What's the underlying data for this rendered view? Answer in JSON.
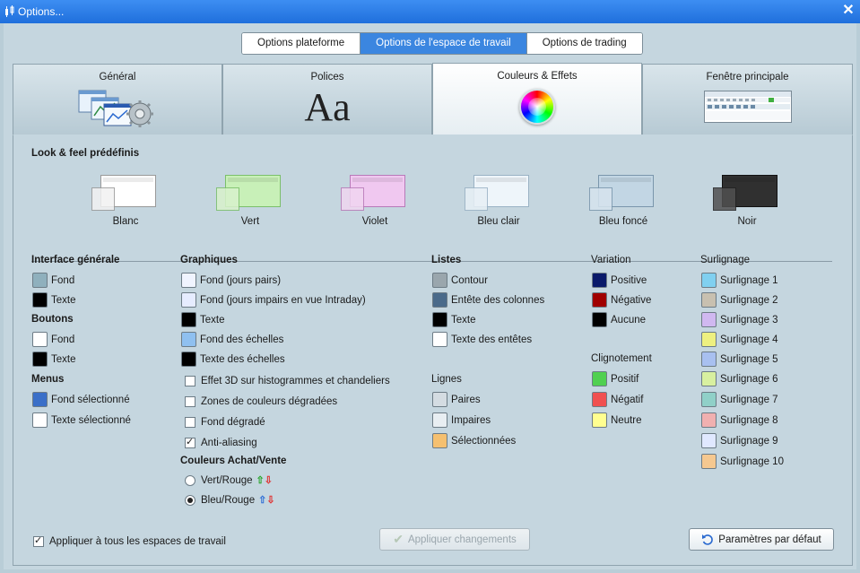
{
  "window": {
    "title": "Options..."
  },
  "top_segments": [
    {
      "label": "Options plateforme",
      "active": false
    },
    {
      "label": "Options de l'espace de travail",
      "active": true
    },
    {
      "label": "Options de trading",
      "active": false
    }
  ],
  "tabs": [
    {
      "label": "Général",
      "icon": "windows-gear-icon",
      "active": false
    },
    {
      "label": "Polices",
      "icon": "font-aa-icon",
      "icon_text": "Aa",
      "active": false
    },
    {
      "label": "Couleurs & Effets",
      "icon": "color-wheel-icon",
      "active": true
    },
    {
      "label": "Fenêtre principale",
      "icon": "main-window-preview-icon",
      "active": false
    }
  ],
  "look_feel": {
    "title": "Look & feel prédéfinis",
    "presets": [
      {
        "label": "Blanc",
        "back": "#ffffff",
        "front": "#f2f2f2"
      },
      {
        "label": "Vert",
        "back": "#c8f0b8",
        "front": "#d8f2cc"
      },
      {
        "label": "Violet",
        "back": "#f0c8f0",
        "front": "#f0d6f0"
      },
      {
        "label": "Bleu clair",
        "back": "#eef5fa",
        "front": "#e8f0f6"
      },
      {
        "label": "Bleu foncé",
        "back": "#c2d6e4",
        "front": "#d6e4ee"
      },
      {
        "label": "Noir",
        "back": "#303030",
        "front": "#505050"
      }
    ]
  },
  "interface": {
    "title": "Interface générale",
    "items": [
      {
        "label": "Fond",
        "color": "#8fb0bd"
      },
      {
        "label": "Texte",
        "color": "#000000"
      }
    ]
  },
  "boutons": {
    "title": "Boutons",
    "items": [
      {
        "label": "Fond",
        "color": "#ffffff"
      },
      {
        "label": "Texte",
        "color": "#000000"
      }
    ]
  },
  "menus": {
    "title": "Menus",
    "items": [
      {
        "label": "Fond sélectionné",
        "color": "#3a6fc8"
      },
      {
        "label": "Texte sélectionné",
        "color": "#ffffff"
      }
    ]
  },
  "graphiques": {
    "title": "Graphiques",
    "items": [
      {
        "label": "Fond (jours pairs)",
        "color": "#f0f4ff"
      },
      {
        "label": "Fond (jours impairs en vue Intraday)",
        "color": "#e6ecff"
      },
      {
        "label": "Texte",
        "color": "#000000"
      },
      {
        "label": "Fond des échelles",
        "color": "#8fc0f0"
      },
      {
        "label": "Texte des échelles",
        "color": "#000000"
      }
    ],
    "checks": [
      {
        "label": "Effet 3D sur histogrammes et chandeliers",
        "checked": false
      },
      {
        "label": "Zones de couleurs dégradées",
        "checked": false
      },
      {
        "label": "Fond dégradé",
        "checked": false
      },
      {
        "label": "Anti-aliasing",
        "checked": true
      }
    ]
  },
  "achat_vente": {
    "title": "Couleurs Achat/Vente",
    "options": [
      {
        "label": "Vert/Rouge",
        "checked": false,
        "up": "⇧",
        "down": "⇩"
      },
      {
        "label": "Bleu/Rouge",
        "checked": true,
        "up": "⇧",
        "down": "⇩"
      }
    ]
  },
  "listes": {
    "title": "Listes",
    "items": [
      {
        "label": "Contour",
        "color": "#9aa6ad"
      },
      {
        "label": "Entête des colonnes",
        "color": "#4a6a8a"
      },
      {
        "label": "Texte",
        "color": "#000000"
      },
      {
        "label": "Texte des entêtes",
        "color": "#ffffff"
      }
    ]
  },
  "lignes": {
    "title": "Lignes",
    "items": [
      {
        "label": "Paires",
        "color": "#d4dce2"
      },
      {
        "label": "Impaires",
        "color": "#e8eef2"
      },
      {
        "label": "Sélectionnées",
        "color": "#f5c070"
      }
    ]
  },
  "variation": {
    "title": "Variation",
    "items": [
      {
        "label": "Positive",
        "color": "#0a1a6a"
      },
      {
        "label": "Négative",
        "color": "#a00000"
      },
      {
        "label": "Aucune",
        "color": "#000000"
      }
    ]
  },
  "clignotement": {
    "title": "Clignotement",
    "items": [
      {
        "label": "Positif",
        "color": "#50d050"
      },
      {
        "label": "Négatif",
        "color": "#f05050"
      },
      {
        "label": "Neutre",
        "color": "#ffff90"
      }
    ]
  },
  "surlignage": {
    "title": "Surlignage",
    "items": [
      {
        "label": "Surlignage 1",
        "color": "#80d0f0"
      },
      {
        "label": "Surlignage 2",
        "color": "#c8c0b0"
      },
      {
        "label": "Surlignage 3",
        "color": "#d0b8f0"
      },
      {
        "label": "Surlignage 4",
        "color": "#eef080"
      },
      {
        "label": "Surlignage 5",
        "color": "#a8c0f0"
      },
      {
        "label": "Surlignage 6",
        "color": "#d8f0a0"
      },
      {
        "label": "Surlignage 7",
        "color": "#90d0c8"
      },
      {
        "label": "Surlignage 8",
        "color": "#f0b0b0"
      },
      {
        "label": "Surlignage 9",
        "color": "#e0e8ff"
      },
      {
        "label": "Surlignage 10",
        "color": "#f5c890"
      }
    ]
  },
  "footer": {
    "apply_all_label": "Appliquer à tous les espaces de travail",
    "apply_all_checked": true,
    "apply_label": "Appliquer changements",
    "default_label": "Paramètres par défaut"
  }
}
